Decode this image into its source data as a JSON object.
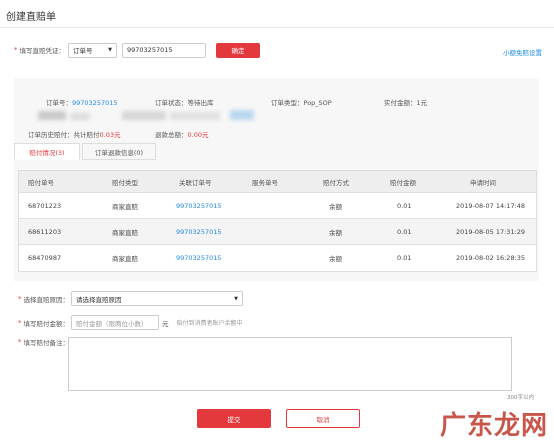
{
  "page": {
    "title": "创建直赔单"
  },
  "voucher": {
    "label": "填写直赔凭证：",
    "type_value": "订单号",
    "order_input": "99703257015",
    "confirm_label": "确定",
    "settings_link": "小额免赔设置"
  },
  "order_info": {
    "order_no_label": "订单号：",
    "order_no": "99703257015",
    "status_label": "订单状态：",
    "status": "等待出库",
    "type_label": "订单类型：",
    "type": "Pop_SOP",
    "paid_label": "实付金额：",
    "paid": "1元",
    "history_label": "订单历史赔付：共计赔付",
    "history_amount": "0.03元",
    "refund_label": "退款总额：",
    "refund_amount": "0.00元"
  },
  "tabs": [
    {
      "label": "赔付情况(3)",
      "active": true
    },
    {
      "label": "订单退款信息(0)",
      "active": false
    }
  ],
  "table": {
    "headers": [
      "赔付单号",
      "赔付类型",
      "关联订单号",
      "服务单号",
      "赔付方式",
      "赔付金额",
      "申请时间"
    ],
    "rows": [
      {
        "id": "68701223",
        "type": "商家直赔",
        "order": "99703257015",
        "service": "",
        "method": "余额",
        "amount": "0.01",
        "time": "2019-08-07 14:17:48"
      },
      {
        "id": "68611203",
        "type": "商家直赔",
        "order": "99703257015",
        "service": "",
        "method": "余额",
        "amount": "0.01",
        "time": "2019-08-05 17:31:29"
      },
      {
        "id": "68470987",
        "type": "商家直赔",
        "order": "99703257015",
        "service": "",
        "method": "余额",
        "amount": "0.01",
        "time": "2019-08-02 16:28:35"
      }
    ]
  },
  "form": {
    "reason_label": "选择直赔原因：",
    "reason_value": "请选择直赔原因",
    "amount_label": "填写赔付金额：",
    "amount_placeholder": "赔付金额（限两位小数）",
    "amount_unit": "元",
    "amount_hint": "赔付到消费者账户余额中",
    "remark_label": "填写赔付备注：",
    "remark_counter": "300字以内"
  },
  "actions": {
    "submit": "提交",
    "cancel": "取消"
  },
  "watermark": "广东龙网",
  "colors": {
    "accent": "#e4393c",
    "link": "#1e88e5"
  }
}
